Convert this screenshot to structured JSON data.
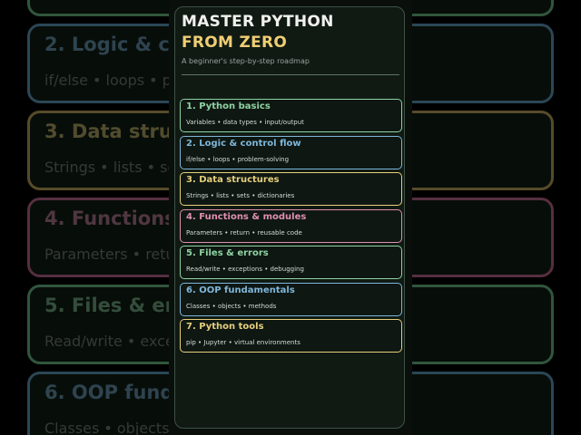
{
  "header": {
    "title_line1": "MASTER PYTHON",
    "title_line2": "FROM ZERO",
    "subtitle": "A beginner's step-by-step roadmap"
  },
  "colors": {
    "green": "#8fd3a2",
    "blue": "#7fb6d9",
    "yellow": "#e6cf7c",
    "pink": "#e08fb0",
    "title_white": "#f1f1ee",
    "title_gold": "#f0cd73"
  },
  "steps": [
    {
      "title": "1. Python basics",
      "desc": "Variables • data types • input/output",
      "color": "#8fd3a2"
    },
    {
      "title": "2. Logic & control flow",
      "desc": "if/else • loops • problem-solving",
      "color": "#7fb6d9"
    },
    {
      "title": "3. Data structures",
      "desc": "Strings • lists • sets • dictionaries",
      "color": "#e6cf7c"
    },
    {
      "title": "4. Functions & modules",
      "desc": "Parameters • return • reusable code",
      "color": "#e08fb0"
    },
    {
      "title": "5. Files & errors",
      "desc": "Read/write • exceptions • debugging",
      "color": "#8fd3a2"
    },
    {
      "title": "6. OOP fundamentals",
      "desc": "Classes • objects • methods",
      "color": "#7fb6d9"
    },
    {
      "title": "7. Python tools",
      "desc": "pip • Jupyter • virtual environments",
      "color": "#e6cf7c"
    }
  ]
}
